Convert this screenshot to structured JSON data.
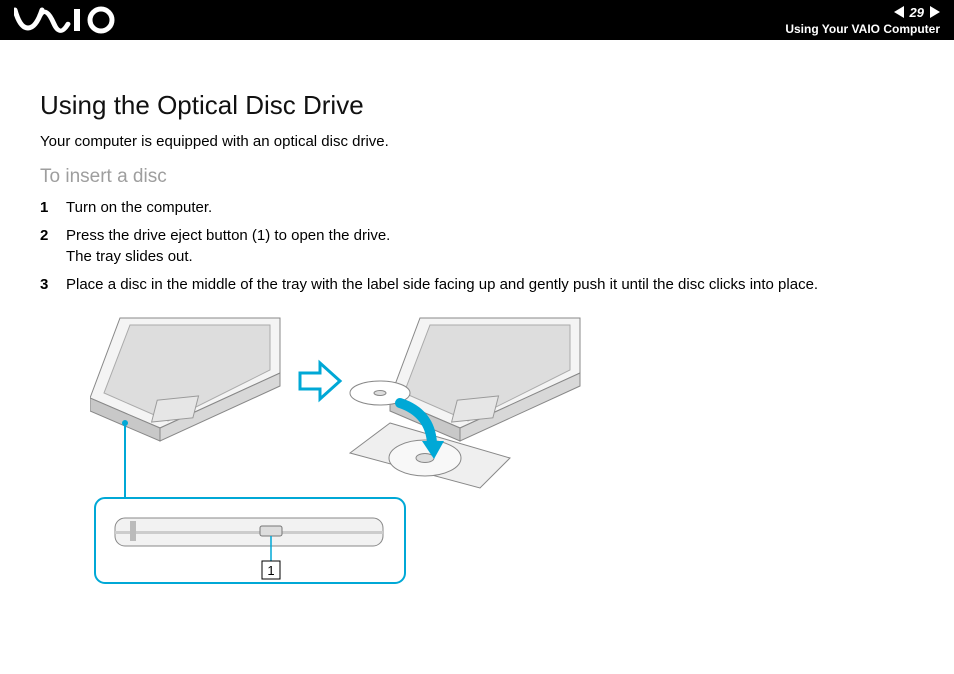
{
  "header": {
    "page_number": "29",
    "section_label": "Using Your VAIO Computer",
    "logo_alt": "VAIO"
  },
  "title": "Using the Optical Disc Drive",
  "intro": "Your computer is equipped with an optical disc drive.",
  "subhead": "To insert a disc",
  "steps": [
    {
      "num": "1",
      "text": "Turn on the computer."
    },
    {
      "num": "2",
      "text": "Press the drive eject button (1) to open the drive.\nThe tray slides out."
    },
    {
      "num": "3",
      "text": "Place a disc in the middle of the tray with the label side facing up and gently push it until the disc clicks into place."
    }
  ],
  "diagram": {
    "callout_label": "1"
  }
}
